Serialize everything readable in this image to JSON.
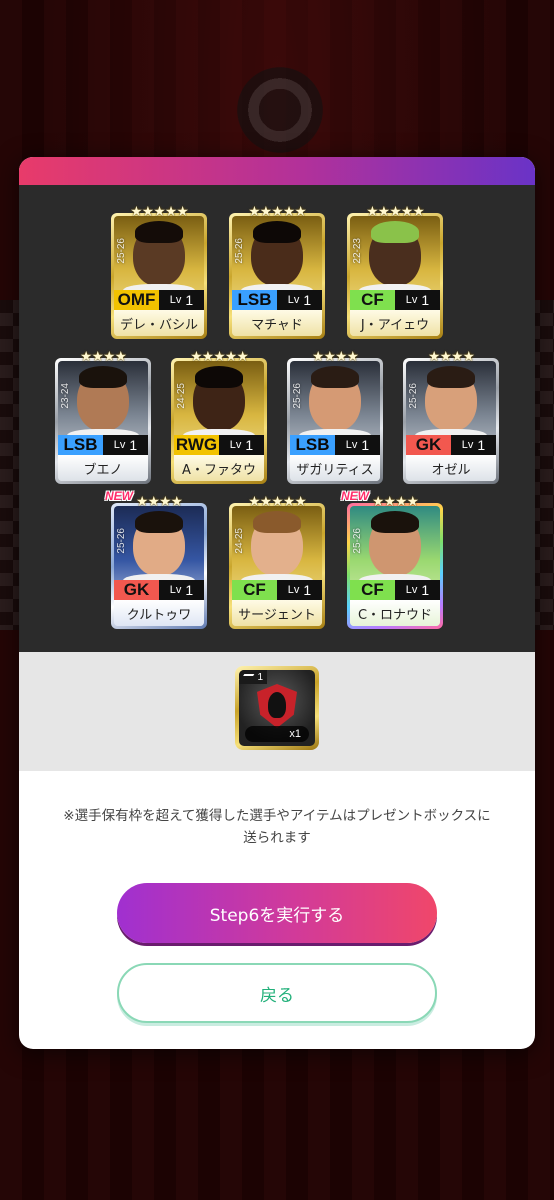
{
  "players": {
    "row1": [
      {
        "stars": "★★★★★",
        "season": "25-26",
        "position": "OMF",
        "level_label": "Lv",
        "level": "1",
        "name": "デレ・バシル",
        "new": ""
      },
      {
        "stars": "★★★★★",
        "season": "25-26",
        "position": "LSB",
        "level_label": "Lv",
        "level": "1",
        "name": "マチャド",
        "new": ""
      },
      {
        "stars": "★★★★★",
        "season": "22-23",
        "position": "CF",
        "level_label": "Lv",
        "level": "1",
        "name": "J・アイェウ",
        "new": ""
      }
    ],
    "row2": [
      {
        "stars": "★★★★",
        "season": "23-24",
        "position": "LSB",
        "level_label": "Lv",
        "level": "1",
        "name": "ブエノ",
        "new": ""
      },
      {
        "stars": "★★★★★",
        "season": "24-25",
        "position": "RWG",
        "level_label": "Lv",
        "level": "1",
        "name": "A・ファタウ",
        "new": ""
      },
      {
        "stars": "★★★★",
        "season": "25-26",
        "position": "LSB",
        "level_label": "Lv",
        "level": "1",
        "name": "ザガリティス",
        "new": ""
      },
      {
        "stars": "★★★★",
        "season": "25-26",
        "position": "GK",
        "level_label": "Lv",
        "level": "1",
        "name": "オゼル",
        "new": ""
      }
    ],
    "row3": [
      {
        "stars": "★★★★",
        "season": "25-26",
        "position": "GK",
        "level_label": "Lv",
        "level": "1",
        "name": "クルトゥワ",
        "new": "NEW"
      },
      {
        "stars": "★★★★★",
        "season": "24-25",
        "position": "CF",
        "level_label": "Lv",
        "level": "1",
        "name": "サージェント",
        "new": ""
      },
      {
        "stars": "★★★★",
        "season": "25-26",
        "position": "CF",
        "level_label": "Lv",
        "level": "1",
        "name": "C・ロナウド",
        "new": "NEW"
      }
    ]
  },
  "item": {
    "rank": "1",
    "quantity": "x1",
    "icon": "shield-icon"
  },
  "notice": "※選手保有枠を超えて獲得した選手やアイテムはプレゼントボックスに送られます",
  "buttons": {
    "primary": "Step6を実行する",
    "secondary": "戻る"
  },
  "colors": {
    "primary_button": "#d13a9a",
    "secondary_text": "#22b07a",
    "header_gradient_start": "#e83b6a",
    "header_gradient_end": "#6a33c7"
  }
}
